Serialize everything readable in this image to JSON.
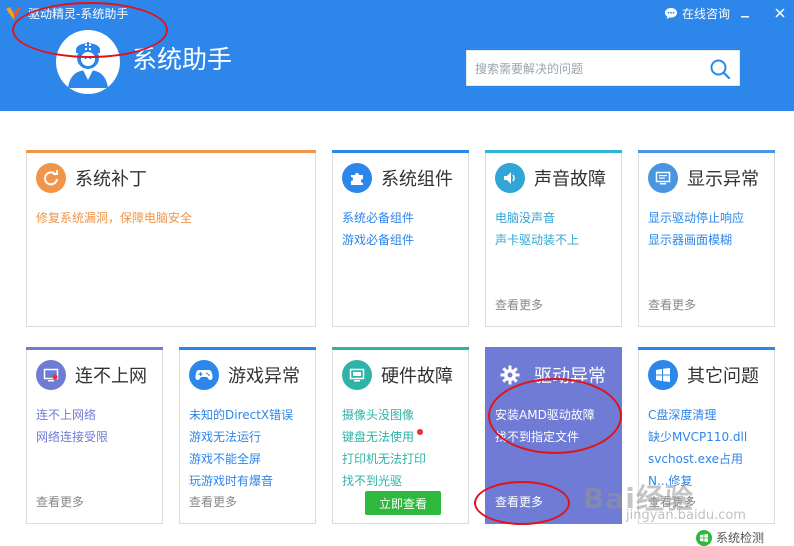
{
  "window": {
    "title": "驱动精灵-系统助手",
    "consult_label": "在线咨询",
    "minimize_icon": "minimize-icon",
    "close_icon": "close-icon"
  },
  "header": {
    "title": "系统助手",
    "background": "#2d86e9",
    "avatar_icon": "doctor-icon"
  },
  "search": {
    "placeholder": "搜索需要解决的问题",
    "icon": "search-icon"
  },
  "cards": [
    {
      "id": "patch",
      "title": "系统补丁",
      "accent": "#f0954a",
      "icon": "patch-refresh-icon",
      "links": [
        "修复系统漏洞，保障电脑安全"
      ],
      "link_color": "#f0954a",
      "more": ""
    },
    {
      "id": "components",
      "title": "系统组件",
      "accent": "#2d86e9",
      "icon": "puzzle-icon",
      "links": [
        "系统必备组件",
        "游戏必备组件"
      ],
      "link_color": "#2d86e9",
      "more": ""
    },
    {
      "id": "audio",
      "title": "声音故障",
      "accent": "#2fb3d4",
      "icon": "speaker-icon",
      "links": [
        "电脑没声音",
        "声卡驱动装不上"
      ],
      "link_color": "#2fa6d6",
      "more": "查看更多"
    },
    {
      "id": "display",
      "title": "显示异常",
      "accent": "#4a95e0",
      "icon": "monitor-icon",
      "links": [
        "显示驱动停止响应",
        "显示器画面模糊"
      ],
      "link_color": "#2d86e9",
      "more": "查看更多"
    },
    {
      "id": "network",
      "title": "连不上网",
      "accent": "#6f7bd4",
      "icon": "network-monitor-icon",
      "links": [
        "连不上网络",
        "网络连接受限"
      ],
      "link_color": "#6f7bd4",
      "more": "查看更多"
    },
    {
      "id": "game",
      "title": "游戏异常",
      "accent": "#2d86e9",
      "icon": "gamepad-icon",
      "links": [
        "未知的DirectX错误",
        "游戏无法运行",
        "游戏不能全屏",
        "玩游戏时有爆音"
      ],
      "link_color": "#2d86e9",
      "more": "查看更多"
    },
    {
      "id": "hardware",
      "title": "硬件故障",
      "accent": "#2fb3a8",
      "icon": "hardware-monitor-icon",
      "links": [
        "摄像头没图像",
        "键盘无法使用",
        "打印机无法打印",
        "找不到光驱"
      ],
      "link_color": "#2fb3a8",
      "more": "",
      "cta": "立即查看"
    },
    {
      "id": "driver",
      "title": "驱动异常",
      "accent": "#6f7bd4",
      "icon": "gear-icon",
      "links": [
        "安装AMD驱动故障",
        "找不到指定文件"
      ],
      "link_color": "#ffffff",
      "more": "查看更多"
    },
    {
      "id": "other",
      "title": "其它问题",
      "accent": "#2d86e9",
      "icon": "windows-icon",
      "links": [
        "C盘深度清理",
        "缺少MVCP110.dll",
        "svchost.exe占用",
        "N...修复"
      ],
      "link_color": "#2d86e9",
      "more": "查看更多"
    }
  ],
  "footer": {
    "system_check": "系统检测",
    "system_check_icon": "windows-small-icon"
  },
  "watermark": {
    "text": "Bai经验",
    "sub": "jingyan.baidu.com"
  },
  "colors": {
    "annotation_ellipse": "#e0141c",
    "cta_green": "#2eb83e",
    "highlight_card": "#6f7bd4"
  }
}
